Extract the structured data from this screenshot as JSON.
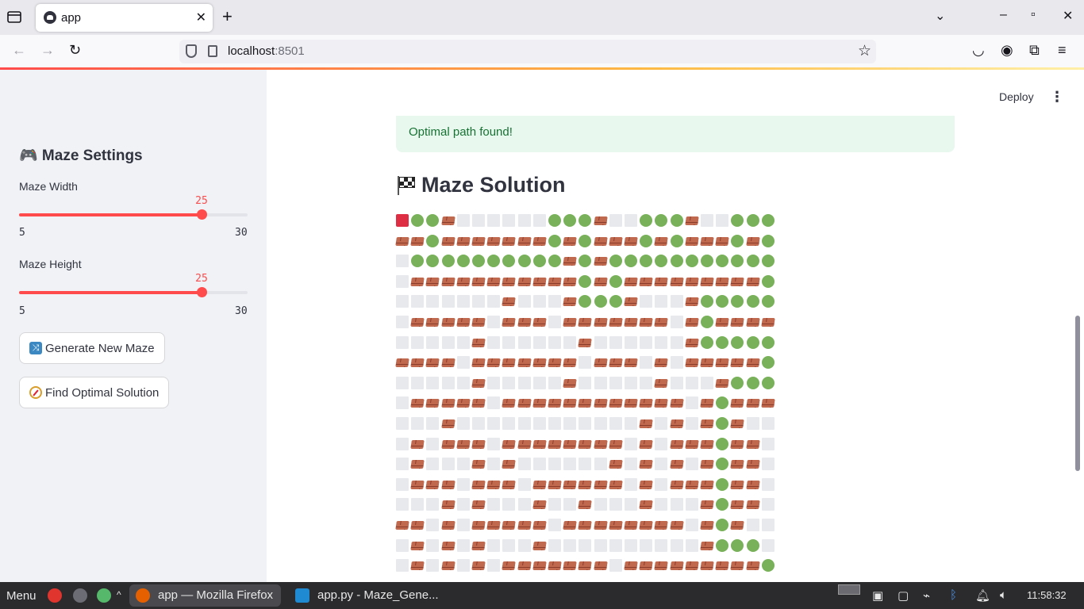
{
  "browser": {
    "tab_title": "app",
    "url_host": "localhost",
    "url_port": ":8501",
    "new_tab": "+",
    "tab_close": "✕"
  },
  "sidebar": {
    "title": "🎮 Maze Settings",
    "width_slider": {
      "label": "Maze Width",
      "value": "25",
      "min": "5",
      "max": "30",
      "fraction": 0.8
    },
    "height_slider": {
      "label": "Maze Height",
      "value": "25",
      "min": "5",
      "max": "30",
      "fraction": 0.8
    },
    "generate_button": "Generate New Maze",
    "solve_button": "Find Optimal Solution"
  },
  "main": {
    "deploy": "Deploy",
    "menu": "⋮",
    "success_message": "Optimal path found!",
    "solution_title": "Maze Solution"
  },
  "maze": {
    "legend": {
      "S": "start",
      "G": "path",
      "W": "wall",
      "O": "open"
    },
    "rows": [
      "SGGWOOOOOOGGGWOOGGGWOOGGG",
      "WWGWWWWWWWGWGWWWGWGWWWGWG",
      "OGGGGGGGGGGWGWGGGGGGGGGGG",
      "OWWWWWWWWWWWGWGWWWWWWWWWG",
      "OOOOOOOWOOOWGGGWOOOWGGGGG",
      "OWWWWWOWWWOWWWWWWWOWGWWWW",
      "OOOOOWOOOOOOWOOOOOOWGGGGG",
      "WWWWOWWWWWWWOWWWOWOWWWWWG",
      "OOOOOWOOOOOWOOOOOWOOOWGGG",
      "OWWWWWOWWWWWWWWWWWWOWGWWW",
      "OOOWOOOOOOOOOOOOWOWOWGWOO",
      "OWOWWWOWWWWWWWWOWOWWWGWWO",
      "OWOOOWOWOOOOOOWOWOWOWGWWO",
      "OWWWOWWWOWWWWWWOWOWWWGWWO",
      "OOOWOWOOOWOOWOOOWOOOWGWWO",
      "WWOWOWWWWWOWWWWWWWWOWGWOO",
      "OWOWOWOOOWOOOOOOOOOOWGGGO",
      "OWOWOWOWWWWWWWOWWWWWWWWWG"
    ]
  },
  "taskbar": {
    "menu": "Menu",
    "task1": "app — Mozilla Firefox",
    "task2": "app.py - Maze_Gene...",
    "clock": "11:58:32"
  }
}
